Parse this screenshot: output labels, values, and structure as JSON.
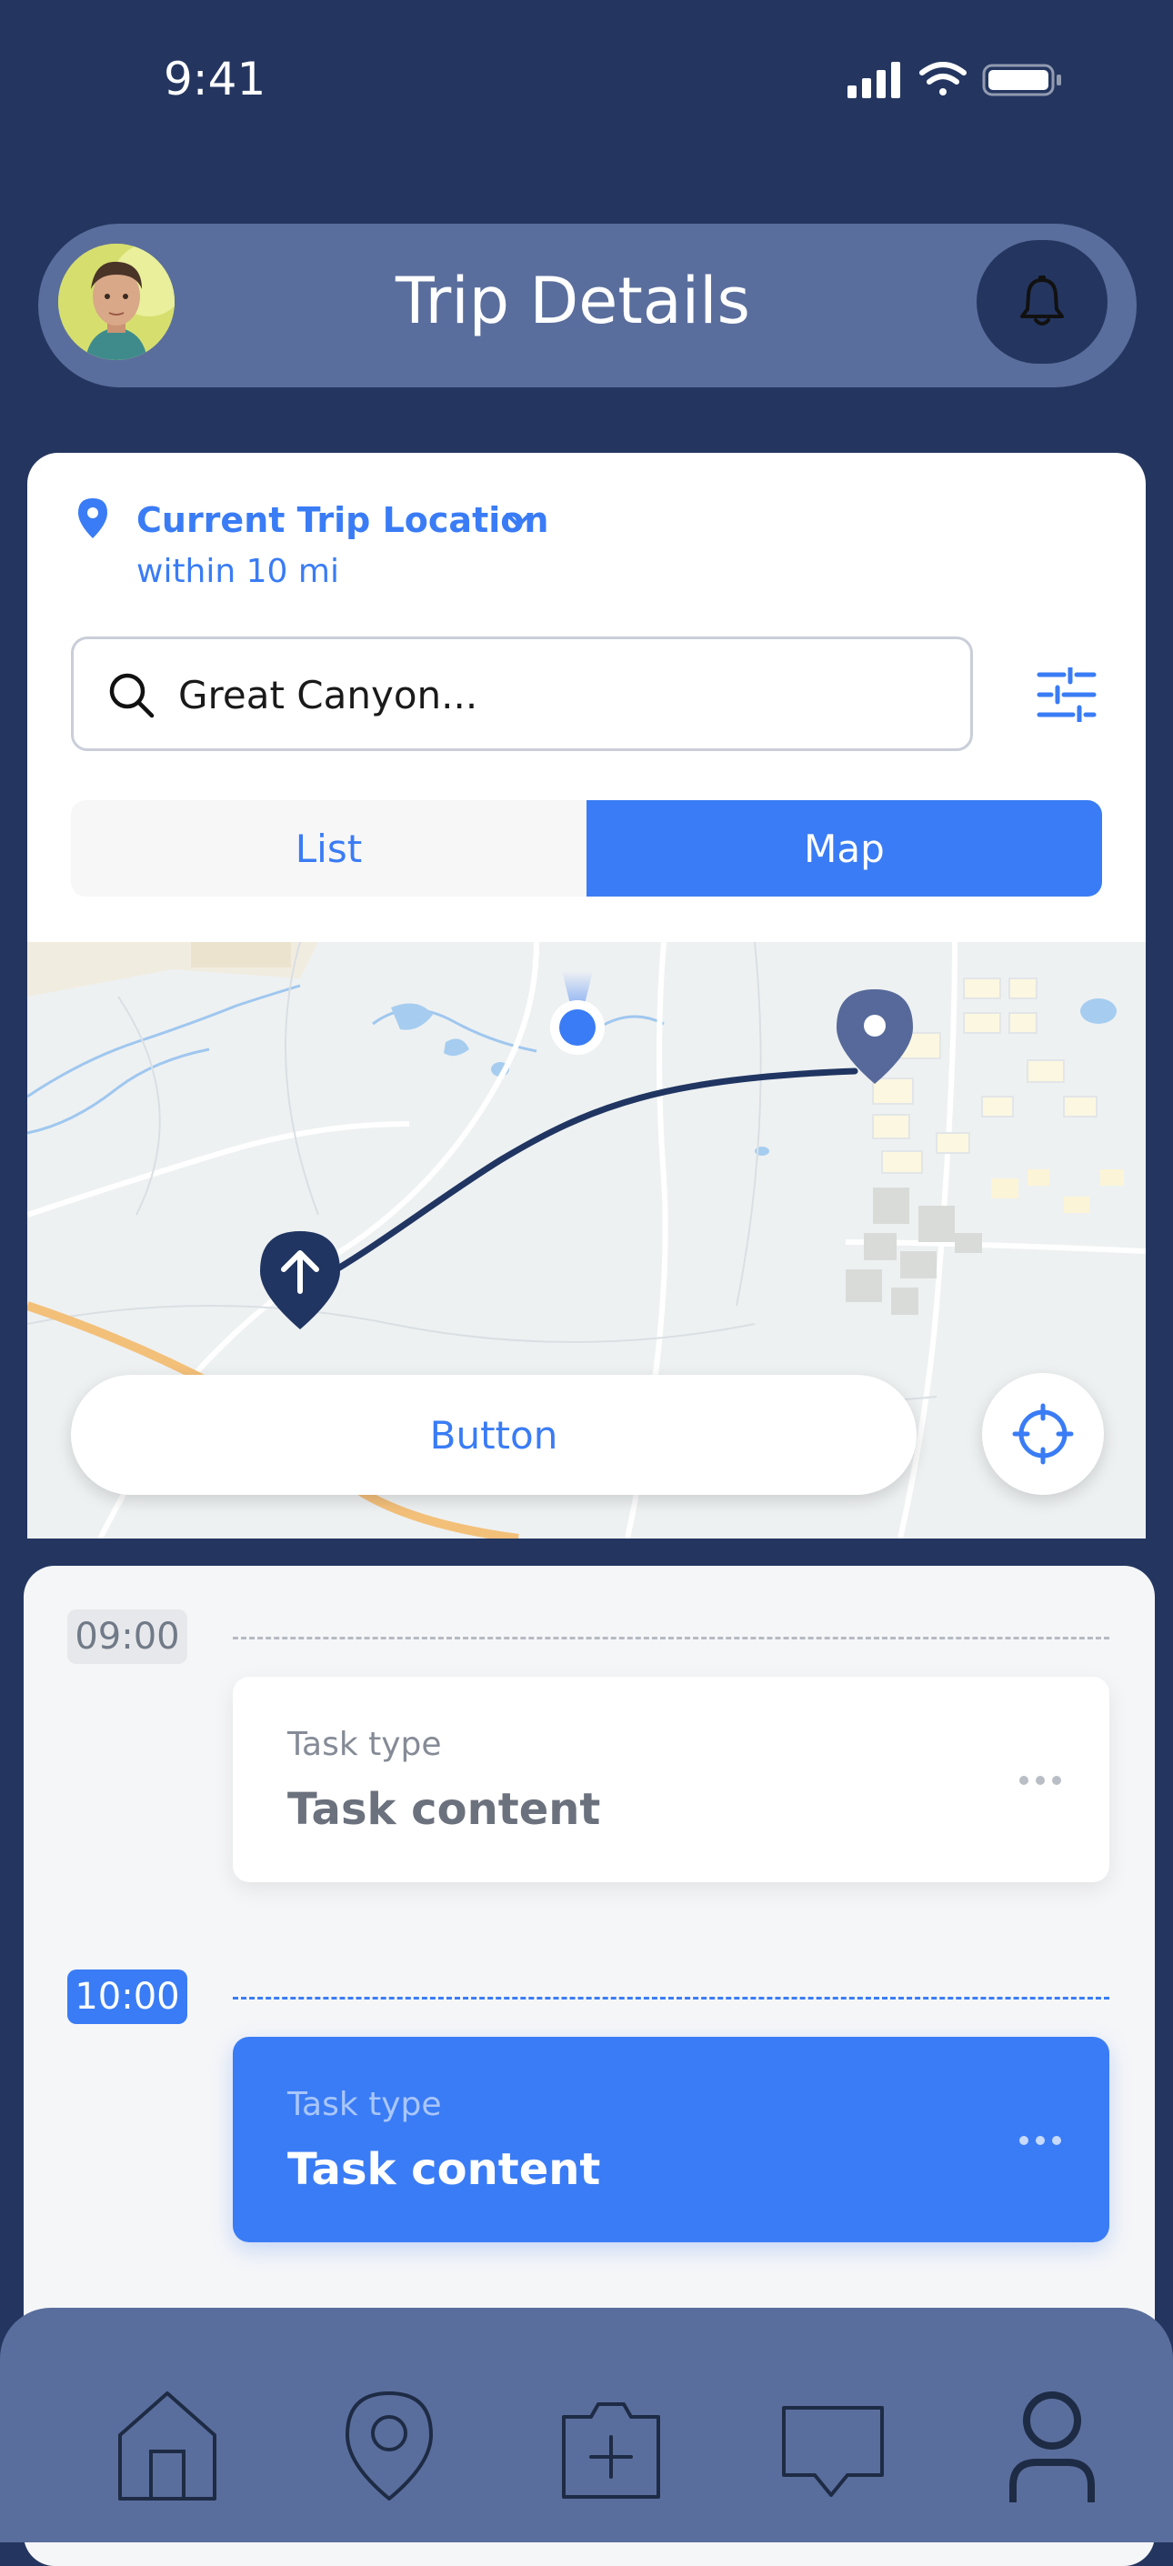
{
  "status_bar": {
    "time": "9:41",
    "icons": [
      "signal-icon",
      "wifi-icon",
      "battery-icon"
    ]
  },
  "header": {
    "title": "Trip Details",
    "avatar": "user-avatar",
    "bell": "bell-icon"
  },
  "location": {
    "title": "Current Trip Location",
    "subtitle": "within 10 mi"
  },
  "search": {
    "value": "Great Canyon..."
  },
  "segmented": {
    "list_label": "List",
    "map_label": "Map",
    "selected": "Map"
  },
  "map": {
    "button_label": "Button"
  },
  "schedule": {
    "slots": [
      {
        "time": "09:00",
        "task_type": "Task type",
        "task_content": "Task content",
        "active": false
      },
      {
        "time": "10:00",
        "task_type": "Task type",
        "task_content": "Task content",
        "active": true
      }
    ]
  },
  "tabbar": {
    "items": [
      "home-icon",
      "location-icon",
      "camera-add-icon",
      "chat-icon",
      "profile-icon"
    ]
  },
  "colors": {
    "primary": "#3a7cf5",
    "navy": "#243660",
    "header_bg": "#5a6e9d"
  }
}
